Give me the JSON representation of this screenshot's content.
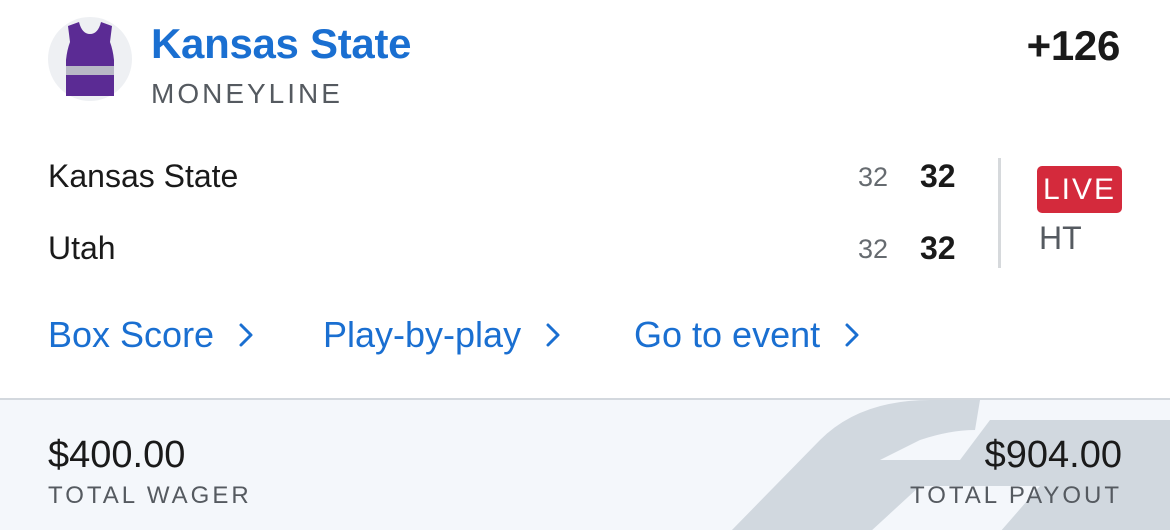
{
  "bet": {
    "team": "Kansas State",
    "market": "MONEYLINE",
    "odds": "+126",
    "jersey_icon": "jersey-icon",
    "jersey_color": "#5b2b94",
    "jersey_stripe_color": "#b8b8c6"
  },
  "game": {
    "teams": [
      {
        "name": "Kansas State",
        "half_score": "32",
        "total_score": "32"
      },
      {
        "name": "Utah",
        "half_score": "32",
        "total_score": "32"
      }
    ],
    "status_badge": "LIVE",
    "status_color": "#d42a3c",
    "period": "HT"
  },
  "links": [
    {
      "label": "Box Score",
      "icon": "chevron-right-icon"
    },
    {
      "label": "Play-by-play",
      "icon": "chevron-right-icon"
    },
    {
      "label": "Go to event",
      "icon": "chevron-right-icon"
    }
  ],
  "footer": {
    "wager_amount": "$400.00",
    "wager_label": "TOTAL WAGER",
    "payout_amount": "$904.00",
    "payout_label": "TOTAL PAYOUT"
  },
  "colors": {
    "accent": "#1a6fd1",
    "footer_bg": "#f4f7fb"
  }
}
